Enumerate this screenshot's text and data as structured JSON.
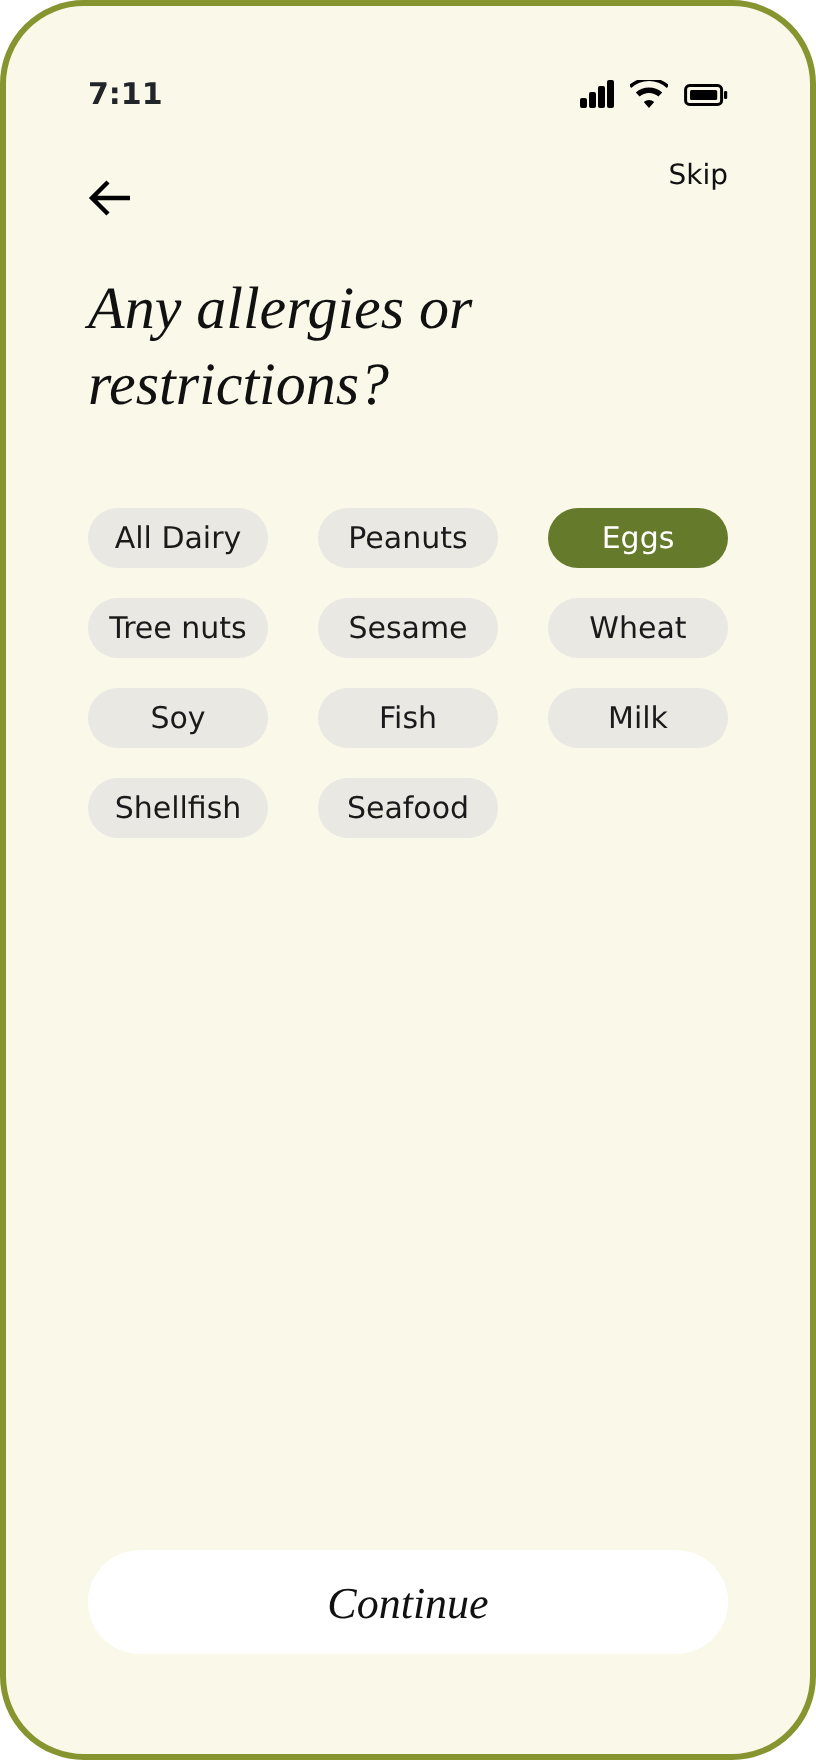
{
  "status_bar": {
    "time": "7:11"
  },
  "header": {
    "skip": "Skip"
  },
  "title": "Any allergies or restrictions?",
  "options": [
    {
      "label": "All Dairy",
      "selected": false
    },
    {
      "label": "Peanuts",
      "selected": false
    },
    {
      "label": "Eggs",
      "selected": true
    },
    {
      "label": "Tree nuts",
      "selected": false
    },
    {
      "label": "Sesame",
      "selected": false
    },
    {
      "label": "Wheat",
      "selected": false
    },
    {
      "label": "Soy",
      "selected": false
    },
    {
      "label": "Fish",
      "selected": false
    },
    {
      "label": "Milk",
      "selected": false
    },
    {
      "label": "Shellfish",
      "selected": false
    },
    {
      "label": "Seafood",
      "selected": false
    }
  ],
  "continue_button": "Continue"
}
